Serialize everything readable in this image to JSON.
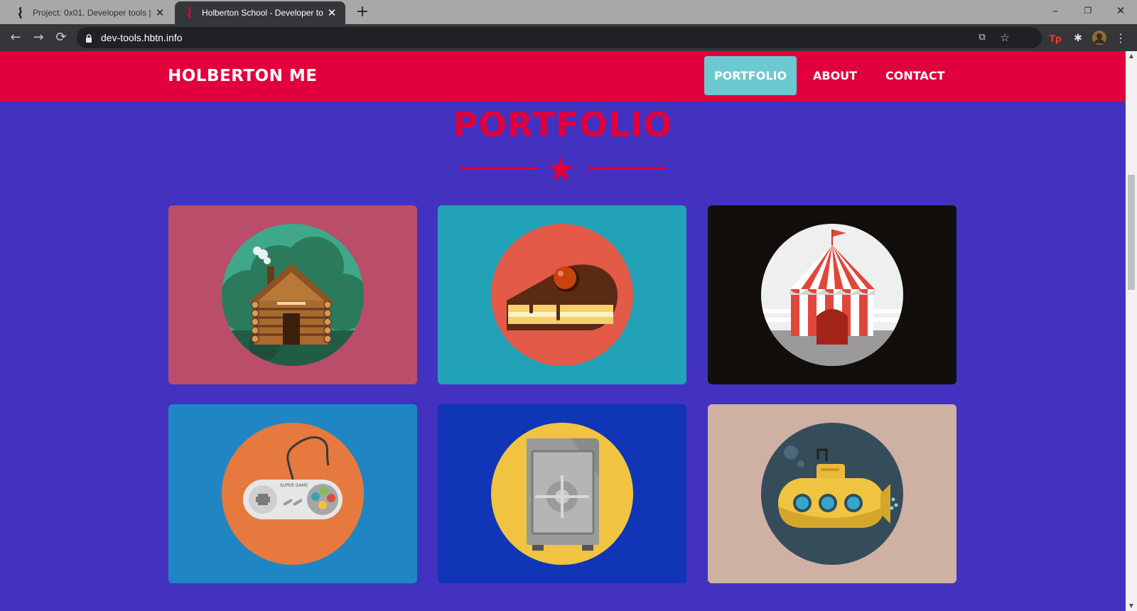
{
  "browser": {
    "tabs": [
      {
        "title": "Project: 0x01. Developer tools | H",
        "active": false
      },
      {
        "title": "Holberton School - Developer to",
        "active": true
      }
    ],
    "url": "dev-tools.hbtn.info"
  },
  "site": {
    "brand": "HOLBERTON ME",
    "nav": [
      "PORTFOLIO",
      "ABOUT",
      "CONTACT"
    ],
    "active_nav": "PORTFOLIO",
    "colors": {
      "primary": "#e1003c",
      "background": "#4332c0",
      "accent": "#6cc9d0"
    }
  },
  "portfolio": {
    "title": "PORTFOLIO",
    "items": [
      {
        "icon": "cabin-icon",
        "card_color": "#b94d6a"
      },
      {
        "icon": "cake-icon",
        "card_color": "#21a2b7"
      },
      {
        "icon": "circus-tent-icon",
        "card_color": "#120e0c"
      },
      {
        "icon": "game-controller-icon",
        "card_color": "#1f86c3"
      },
      {
        "icon": "safe-icon",
        "card_color": "#1035b7"
      },
      {
        "icon": "submarine-icon",
        "card_color": "#cfb1a3"
      }
    ],
    "controller_label": "SUPER GAME"
  }
}
